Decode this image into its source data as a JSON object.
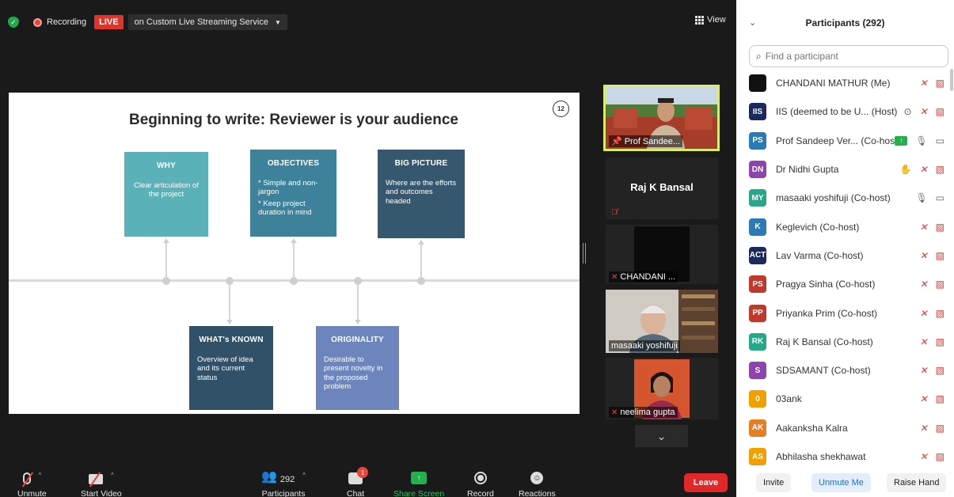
{
  "topbar": {
    "recording_label": "Recording",
    "live_badge": "LIVE",
    "stream_label": "on Custom Live Streaming Service",
    "view_label": "View"
  },
  "slide": {
    "title": "Beginning to write: Reviewer is your audience",
    "number": "12",
    "cards": {
      "why": {
        "title": "WHY",
        "lines": [
          "Clear articulation of the project"
        ]
      },
      "objectives": {
        "title": "OBJECTIVES",
        "lines": [
          "* Simple and non-jargon",
          "* Keep project duration in mind"
        ]
      },
      "big_picture": {
        "title": "BIG PICTURE",
        "lines": [
          "Where are the efforts and outcomes headed"
        ]
      },
      "whats_known": {
        "title": "WHAT's KNOWN",
        "lines": [
          "Overview of idea and its current status"
        ]
      },
      "originality": {
        "title": "ORIGINALITY",
        "lines": [
          "Desirable to present novelty in the proposed problem"
        ]
      }
    },
    "colors": {
      "why": "#5ab1b8",
      "objectives": "#3d819a",
      "big_picture": "#36586e",
      "whats_known": "#315168",
      "originality": "#6c86bd"
    }
  },
  "video_tiles": {
    "prof": "Prof Sandee...",
    "raj": "Raj K Bansal",
    "chandani": "CHANDANI ...",
    "masaaki": "masaaki yoshifuji",
    "neelima": "neelima gupta"
  },
  "toolbar": {
    "unmute": "Unmute",
    "start_video": "Start Video",
    "participants": "Participants",
    "participants_count": "292",
    "chat": "Chat",
    "chat_badge": "1",
    "share_screen": "Share Screen",
    "record": "Record",
    "reactions": "Reactions",
    "leave": "Leave"
  },
  "panel": {
    "title": "Participants (292)",
    "search_placeholder": "Find a participant",
    "participants": [
      {
        "initials": "",
        "name": "CHANDANI MATHUR (Me)",
        "color": "#111111",
        "icons": [
          "mic-off",
          "cam-off"
        ]
      },
      {
        "initials": "IIS",
        "name": "IIS (deemed to be U... (Host)",
        "color": "#1b2a5c",
        "icons": [
          "record",
          "mic-off",
          "cam-off"
        ]
      },
      {
        "initials": "PS",
        "name": "Prof Sandeep Ver... (Co-host)",
        "color": "#2a7ab8",
        "icons": [
          "share",
          "mic",
          "cam"
        ]
      },
      {
        "initials": "DN",
        "name": "Dr Nidhi Gupta",
        "color": "#8e44ad",
        "icons": [
          "hand",
          "mic-off",
          "cam-off"
        ]
      },
      {
        "initials": "MY",
        "name": "masaaki yoshifuji (Co-host)",
        "color": "#27a88a",
        "icons": [
          "mic",
          "cam"
        ]
      },
      {
        "initials": "K",
        "name": "Keglevich (Co-host)",
        "color": "#2a7ab8",
        "icons": [
          "mic-off",
          "cam-off"
        ]
      },
      {
        "initials": "ACT",
        "name": "Lav Varma (Co-host)",
        "color": "#1b2a5c",
        "icons": [
          "mic-off",
          "cam-off"
        ]
      },
      {
        "initials": "PS",
        "name": "Pragya Sinha (Co-host)",
        "color": "#c0392b",
        "icons": [
          "mic-off",
          "cam-off"
        ]
      },
      {
        "initials": "PP",
        "name": "Priyanka Prim (Co-host)",
        "color": "#c0392b",
        "icons": [
          "mic-off",
          "cam-off"
        ]
      },
      {
        "initials": "RK",
        "name": "Raj K Bansal (Co-host)",
        "color": "#27a88a",
        "icons": [
          "mic-off",
          "cam-off"
        ]
      },
      {
        "initials": "S",
        "name": "SDSAMANT (Co-host)",
        "color": "#8e44ad",
        "icons": [
          "mic-off",
          "cam-off"
        ]
      },
      {
        "initials": "0",
        "name": "03ank",
        "color": "#f0a000",
        "icons": [
          "mic-off",
          "cam-off"
        ]
      },
      {
        "initials": "AK",
        "name": "Aakanksha Kalra",
        "color": "#e67e22",
        "icons": [
          "mic-off",
          "cam-off"
        ]
      },
      {
        "initials": "AS",
        "name": "Abhilasha shekhawat",
        "color": "#f0a000",
        "icons": [
          "mic-off",
          "cam-off"
        ]
      }
    ],
    "invite": "Invite",
    "unmute_me": "Unmute Me",
    "raise_hand": "Raise Hand"
  }
}
